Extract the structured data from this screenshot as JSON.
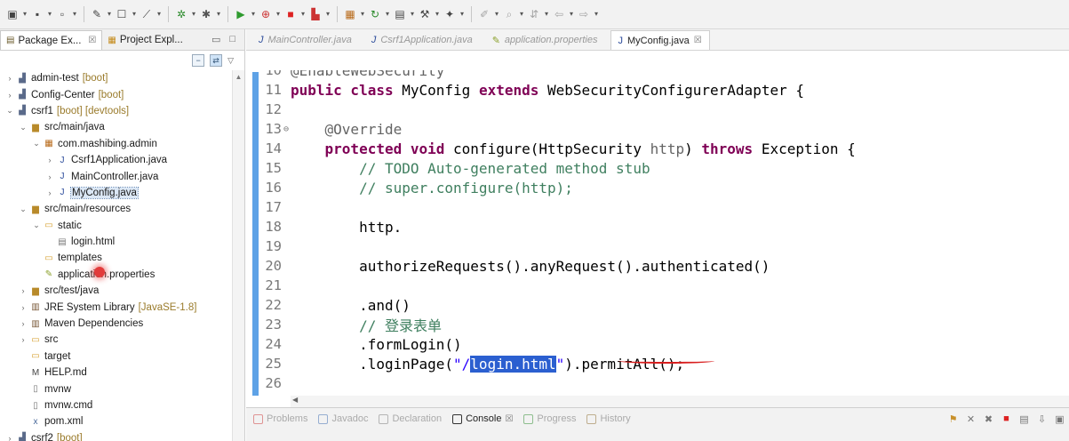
{
  "colors": {
    "keyword": "#7f0055",
    "annotation": "#646464",
    "comment": "#3f7f5f",
    "string": "#2a00ff",
    "selection": "#2b5fd0",
    "gutter_change": "#5ea2e6",
    "squiggle": "#d81e1e"
  },
  "toolbar": {
    "buttons": [
      "new-icon",
      "save-icon",
      "save-all-icon",
      "wand-icon",
      "task-icon",
      "skip-icon",
      "debug-icon",
      "bug-icon",
      "run-icon",
      "run-config-icon",
      "stop-icon",
      "server-icon",
      "package-icon",
      "refresh-icon",
      "toolbox-icon",
      "tools-icon",
      "pin-icon",
      "annotation-icon",
      "search-icon",
      "nav-icon",
      "back-icon",
      "forward-icon"
    ]
  },
  "left_panel": {
    "tabs": [
      {
        "label": "Package Ex...",
        "icon": "package-explorer-icon",
        "close": "☒"
      },
      {
        "label": "Project Expl...",
        "icon": "project-explorer-icon"
      }
    ],
    "minimize": "▭",
    "maximize": "□",
    "tree": [
      {
        "label": "admin-test",
        "deco": "[boot]",
        "level": 0,
        "icon": "project-icon",
        "twisty": "collapsed"
      },
      {
        "label": "Config-Center",
        "deco": "[boot]",
        "level": 0,
        "icon": "project-icon",
        "twisty": "collapsed"
      },
      {
        "label": "csrf1",
        "deco": "[boot] [devtools]",
        "level": 0,
        "icon": "project-icon",
        "twisty": "expanded"
      },
      {
        "label": "src/main/java",
        "deco": "",
        "level": 1,
        "icon": "source-folder-icon",
        "twisty": "expanded"
      },
      {
        "label": "com.mashibing.admin",
        "deco": "",
        "level": 2,
        "icon": "package-icon",
        "twisty": "expanded"
      },
      {
        "label": "Csrf1Application.java",
        "deco": "",
        "level": 3,
        "icon": "java-file-icon",
        "twisty": "collapsed"
      },
      {
        "label": "MainController.java",
        "deco": "",
        "level": 3,
        "icon": "java-file-icon",
        "twisty": "collapsed"
      },
      {
        "label": "MyConfig.java",
        "deco": "",
        "level": 3,
        "icon": "java-file-icon",
        "twisty": "collapsed",
        "selected": true
      },
      {
        "label": "src/main/resources",
        "deco": "",
        "level": 1,
        "icon": "source-folder-icon",
        "twisty": "expanded"
      },
      {
        "label": "static",
        "deco": "",
        "level": 2,
        "icon": "folder-icon",
        "twisty": "expanded"
      },
      {
        "label": "login.html",
        "deco": "",
        "level": 3,
        "icon": "html-file-icon",
        "twisty": "none"
      },
      {
        "label": "templates",
        "deco": "",
        "level": 2,
        "icon": "folder-icon",
        "twisty": "none"
      },
      {
        "label": "application.properties",
        "deco": "",
        "level": 2,
        "icon": "properties-file-icon",
        "twisty": "none"
      },
      {
        "label": "src/test/java",
        "deco": "",
        "level": 1,
        "icon": "source-folder-icon",
        "twisty": "collapsed"
      },
      {
        "label": "JRE System Library",
        "deco": "[JavaSE-1.8]",
        "level": 1,
        "icon": "library-icon",
        "twisty": "collapsed"
      },
      {
        "label": "Maven Dependencies",
        "deco": "",
        "level": 1,
        "icon": "library-icon",
        "twisty": "collapsed"
      },
      {
        "label": "src",
        "deco": "",
        "level": 1,
        "icon": "folder-icon",
        "twisty": "collapsed"
      },
      {
        "label": "target",
        "deco": "",
        "level": 1,
        "icon": "folder-icon",
        "twisty": "none"
      },
      {
        "label": "HELP.md",
        "deco": "",
        "level": 1,
        "icon": "markdown-file-icon",
        "twisty": "none"
      },
      {
        "label": "mvnw",
        "deco": "",
        "level": 1,
        "icon": "file-icon",
        "twisty": "none"
      },
      {
        "label": "mvnw.cmd",
        "deco": "",
        "level": 1,
        "icon": "file-icon",
        "twisty": "none"
      },
      {
        "label": "pom.xml",
        "deco": "",
        "level": 1,
        "icon": "xml-file-icon",
        "twisty": "none"
      },
      {
        "label": "csrf2",
        "deco": "[boot]",
        "level": 0,
        "icon": "project-icon",
        "twisty": "collapsed"
      }
    ]
  },
  "editor": {
    "tabs": [
      {
        "label": "MainController.java",
        "active": false
      },
      {
        "label": "Csrf1Application.java",
        "active": false
      },
      {
        "label": "application.properties",
        "active": false
      },
      {
        "label": "MyConfig.java",
        "active": true,
        "close": "☒"
      }
    ],
    "lines": [
      {
        "n": "10",
        "tokens": [
          {
            "t": "@EnableWebSecurity",
            "c": "ann"
          }
        ]
      },
      {
        "n": "11",
        "tokens": [
          {
            "t": "public class ",
            "c": "kw"
          },
          {
            "t": "MyConfig ",
            "c": ""
          },
          {
            "t": "extends ",
            "c": "kw"
          },
          {
            "t": "WebSecurityConfigurerAdapter {",
            "c": ""
          }
        ]
      },
      {
        "n": "12",
        "tokens": []
      },
      {
        "n": "13",
        "fold": "⊖",
        "tokens": [
          {
            "t": "    @Override",
            "c": "ann"
          }
        ]
      },
      {
        "n": "14",
        "tokens": [
          {
            "t": "    protected void ",
            "c": "kw"
          },
          {
            "t": "configure(HttpSecurity ",
            "c": ""
          },
          {
            "t": "http",
            "c": "ann"
          },
          {
            "t": ") ",
            "c": ""
          },
          {
            "t": "throws ",
            "c": "kw"
          },
          {
            "t": "Exception {",
            "c": ""
          }
        ]
      },
      {
        "n": "15",
        "tokens": [
          {
            "t": "        // TODO Auto-generated method stub",
            "c": "cm"
          }
        ]
      },
      {
        "n": "16",
        "tokens": [
          {
            "t": "        // super.configure(http);",
            "c": "cm"
          }
        ]
      },
      {
        "n": "17",
        "tokens": []
      },
      {
        "n": "18",
        "tokens": [
          {
            "t": "        http.",
            "c": ""
          }
        ]
      },
      {
        "n": "19",
        "tokens": []
      },
      {
        "n": "20",
        "tokens": [
          {
            "t": "        authorizeRequests().anyRequest().authenticated()",
            "c": ""
          }
        ]
      },
      {
        "n": "21",
        "tokens": []
      },
      {
        "n": "22",
        "tokens": [
          {
            "t": "        .and()",
            "c": ""
          }
        ]
      },
      {
        "n": "23",
        "tokens": [
          {
            "t": "        // 登录表单",
            "c": "cm"
          }
        ]
      },
      {
        "n": "24",
        "tokens": [
          {
            "t": "        .formLogin()",
            "c": ""
          }
        ]
      },
      {
        "n": "25",
        "tokens": [
          {
            "t": "        .loginPage(",
            "c": ""
          },
          {
            "t": "\"/",
            "c": "str"
          },
          {
            "t": "login.html",
            "c": "hl"
          },
          {
            "t": "\"",
            "c": "str"
          },
          {
            "t": ").permitAll();",
            "c": ""
          }
        ]
      },
      {
        "n": "26",
        "tokens": []
      },
      {
        "n": "27",
        "tokens": [
          {
            "t": "        ;",
            "c": ""
          }
        ]
      }
    ]
  },
  "bottom_panel": {
    "tabs": [
      {
        "label": "Problems",
        "active": false
      },
      {
        "label": "Javadoc",
        "active": false
      },
      {
        "label": "Declaration",
        "active": false
      },
      {
        "label": "Console",
        "active": true,
        "close": "☒"
      },
      {
        "label": "Progress",
        "active": false
      },
      {
        "label": "History",
        "active": false
      }
    ]
  }
}
